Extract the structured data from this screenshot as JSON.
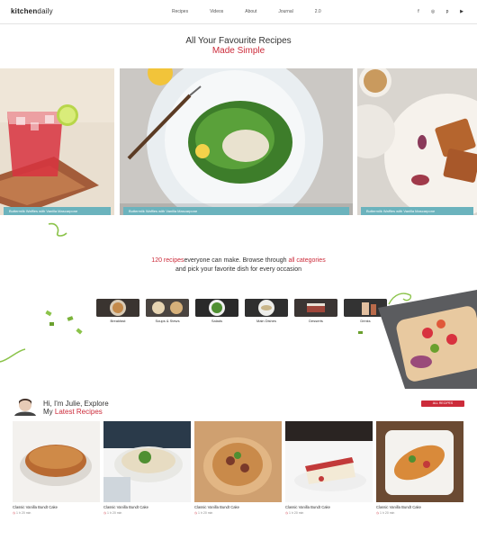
{
  "brand": {
    "name_a": "kitchen",
    "name_b": "daily"
  },
  "nav": {
    "items": [
      "Recipes",
      "Videos",
      "About",
      "Journal",
      "2.0"
    ]
  },
  "social": {
    "icons": [
      "facebook-icon",
      "instagram-icon",
      "pinterest-icon",
      "youtube-icon"
    ],
    "glyphs": [
      "f",
      "◎",
      "p",
      "▶"
    ]
  },
  "hero": {
    "line1": "All Your Favourite Recipes",
    "line2": "Made Simple"
  },
  "slider": {
    "captions": [
      "Buttermilk Waffles with Vanilla Mascarpone",
      "Buttermilk Waffles with Vanilla Mascarpone",
      "Buttermilk Waffles with Vanilla Mascarpone"
    ]
  },
  "intro": {
    "count": "120 recipes",
    "text1": "everyone can make. Browse through ",
    "all_categories": "all categories",
    "text2": "and pick your favorite dish for every occasion"
  },
  "categories": [
    "Breakfast",
    "Soups & Stews",
    "Salads",
    "Main Dishes",
    "Desserts",
    "Drinks"
  ],
  "latest": {
    "line1": "Hi, I'm Julie, Explore",
    "line2a": "My ",
    "line2b": "Latest Recipes",
    "button": "ALL RECIPES"
  },
  "cards": [
    {
      "title": "Classic Vanilla Bundt Cake",
      "time": "1 h 20 min"
    },
    {
      "title": "Classic Vanilla Bundt Cake",
      "time": "1 h 20 min"
    },
    {
      "title": "Classic Vanilla Bundt Cake",
      "time": "1 h 20 min"
    },
    {
      "title": "Classic Vanilla Bundt Cake",
      "time": "1 h 20 min"
    },
    {
      "title": "Classic Vanilla Bundt Cake",
      "time": "1 h 20 min"
    }
  ],
  "colors": {
    "accent": "#cc2b3a",
    "caption_bg": "#6bb3bd",
    "herb": "#8bc34a"
  }
}
